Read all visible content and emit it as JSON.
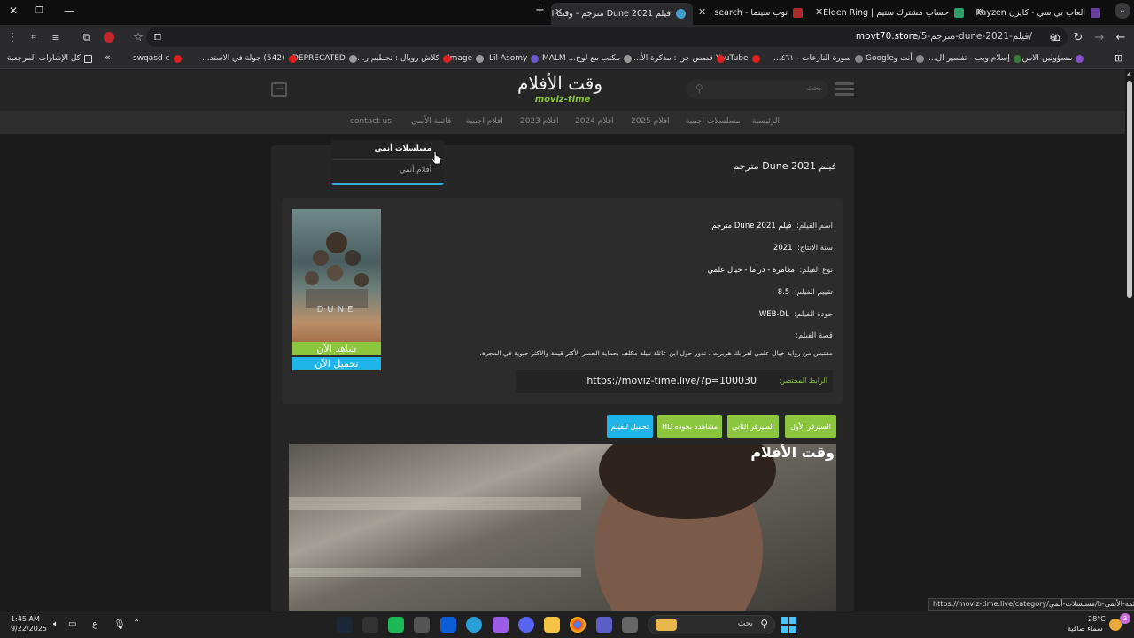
{
  "browser": {
    "tabs": [
      {
        "title": "العاب بي سي - كايزن Kayzen - ال",
        "color": "#6b3fa0"
      },
      {
        "title": "حساب مشترك ستيم | Elden Ring",
        "color": "#2ea06a"
      },
      {
        "title": "توب سينما - search",
        "color": "#b02a2a"
      },
      {
        "title": "فيلم Dune 2021 مترجم - وقت الأ",
        "color": "#3fa0d0"
      }
    ],
    "new_tab": "+",
    "url_domain": "movt70.store",
    "url_path": "/مترجم-5-dune-2021-فيلم/"
  },
  "bookmarks": {
    "items": [
      {
        "label": "مسؤولين-الامن...",
        "color": "#8a4fd0"
      },
      {
        "label": "إسلام ويب - تفسير ال...",
        "color": "#3a7a3a"
      },
      {
        "label": "أنت وGoogle",
        "color": "#888888"
      },
      {
        "label": "سورة النازعات - ٤٦١...",
        "color": "#888888"
      },
      {
        "label": "YouTube",
        "color": "#e02020"
      },
      {
        "label": "قصص جن : مذكرة الأ...",
        "color": "#e02020"
      },
      {
        "label": "مكتب مع لوح... MALM",
        "color": "#999999"
      },
      {
        "label": "Lil Asomy",
        "color": "#6a5acd"
      },
      {
        "label": "Image",
        "color": "#999999"
      },
      {
        "label": "كلاش رويال : تحطيم ر...",
        "color": "#e02020"
      },
      {
        "label": "DEPRECATED",
        "color": "#999999"
      },
      {
        "label": "(542) جولة في الاستد...",
        "color": "#e02020"
      },
      {
        "label": "swqasd c",
        "color": "#e02020"
      }
    ],
    "more": "»",
    "all_bookmarks": "كل الإشارات المرجعية"
  },
  "site": {
    "logo_ar": "وقت الأفلام",
    "logo_en": "moviz-time",
    "search_placeholder": "بحث",
    "nav": [
      "الرئيسية",
      "مسلسلات اجنبية",
      "افلام 2025",
      "افلام 2024",
      "افلام 2023",
      "افلام اجنبية",
      "قائمة الأنمي",
      "contact us"
    ],
    "dropdown": {
      "items": [
        "مسلسلات أنمي",
        "أفلام أنمي"
      ]
    }
  },
  "movie": {
    "page_title": "فيلم Dune 2021 مترجم",
    "fields": [
      {
        "label": "اسم الفيلم:",
        "value": "فيلم Dune 2021 مترجم"
      },
      {
        "label": "سنة الإنتاج:",
        "value": "2021"
      },
      {
        "label": "نوع الفيلم:",
        "value": "مغامرة - دراما - خيال علمي"
      },
      {
        "label": "تقييم الفيلم:",
        "value": "8.5"
      },
      {
        "label": "جودة الفيلم:",
        "value": "WEB-DL"
      },
      {
        "label": "قصة الفيلم:",
        "value": ""
      }
    ],
    "story": "مقتبس من رواية خيال علمي لفرانك هربرت ، تدور حول ابن عائلة نبيلة مكلف بحماية الحصر الأكثر قيمة والأكثر حيوية في المجرة.",
    "short_link_label": "الرابط المختصر:",
    "short_link": "https://moviz-time.live/?p=100030",
    "poster_title": "DUNE",
    "watch_now": "شاهد الآن",
    "download_now": "تحميل الآن",
    "buttons": [
      "السيرفر الأول",
      "السيرفر الثاني",
      "مشاهده بجوده HD",
      "تحميل للفيلم"
    ],
    "video_watermark": "وقت الأفلام"
  },
  "status_url": "https://moviz-time.live/category/مسلسلات-أنمي/b-قائمة-الأنمي/",
  "taskbar": {
    "time": "1:45 AM",
    "date": "9/22/2025",
    "lang": "ع",
    "weather_temp": "28°C",
    "weather_desc": "سماء صافية",
    "search_placeholder": "بحث",
    "notif_count": "2"
  }
}
